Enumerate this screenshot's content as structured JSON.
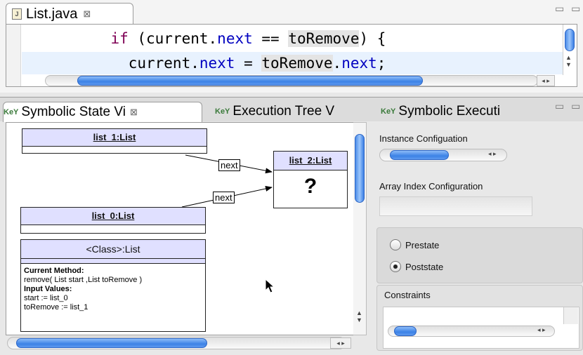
{
  "editor": {
    "tab_title": "List.java",
    "tab_close": "⊠",
    "window_buttons": "▭ ▭",
    "code": {
      "line1": {
        "indent": "          ",
        "kw": "if",
        "open": " (current.",
        "field": "next",
        "mid": " == ",
        "hl": "toRemove",
        "end": ") {"
      },
      "line2": {
        "indent": "            ",
        "a": "current.",
        "field1": "next",
        "mid": " = ",
        "hl": "toRemove",
        "dot": ".",
        "field2": "next",
        "end": ";"
      }
    }
  },
  "view_tabs": [
    {
      "label": "Symbolic State Vi",
      "close": "⊠",
      "icon": "KeY"
    },
    {
      "label": "Execution Tree V",
      "icon": "KeY"
    },
    {
      "label": "Symbolic Executi",
      "icon": "KeY"
    }
  ],
  "view_window_buttons": "▭ ▭",
  "diagram": {
    "list1": "list_1:List",
    "list2": "list_2:List",
    "list2_value": "?",
    "list0": "list_0:List",
    "edge1": "next",
    "edge2": "next",
    "class_box": {
      "title": "<Class>:List",
      "current_method_label": "Current Method:",
      "current_method": "remove( List start ,List toRemove )",
      "input_values_label": "Input Values:",
      "input1": "start := list_0",
      "input2": "toRemove := list_1"
    }
  },
  "panel": {
    "instance_config": "Instance Configuation",
    "array_index_config": "Array Index Configuration",
    "prestate": "Prestate",
    "poststate": "Poststate",
    "selected_state": "Poststate",
    "constraints": "Constraints"
  },
  "icons": [
    "java-file-icon",
    "close-icon",
    "key-view-icon",
    "mouse-pointer-icon",
    "scroll-arrow-icon",
    "minimize-icon",
    "maximize-icon"
  ]
}
